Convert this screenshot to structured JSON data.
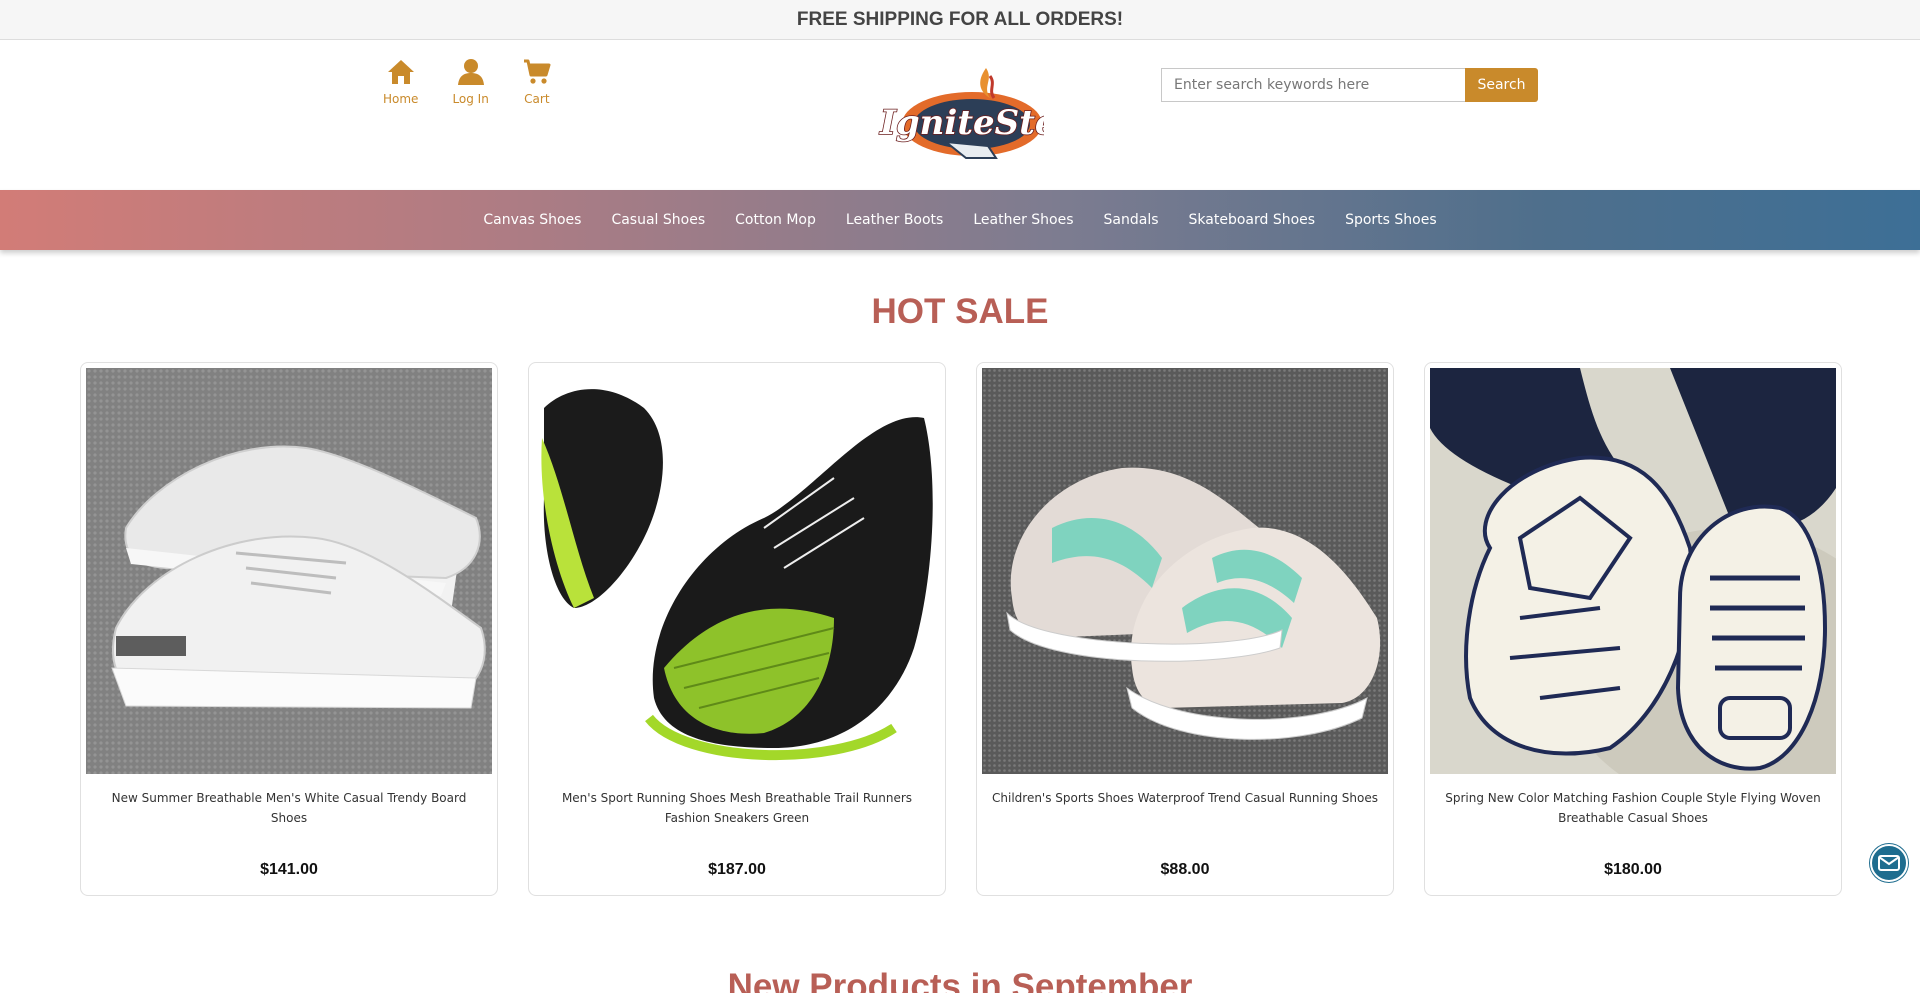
{
  "promo": {
    "text": "FREE SHIPPING FOR ALL ORDERS!"
  },
  "header": {
    "nav": [
      {
        "label": "Home",
        "icon": "home-icon"
      },
      {
        "label": "Log In",
        "icon": "user-icon"
      },
      {
        "label": "Cart",
        "icon": "cart-icon"
      }
    ],
    "logo": {
      "text": "IgniteStep"
    },
    "search": {
      "placeholder": "Enter search keywords here",
      "button_label": "Search"
    }
  },
  "categories": [
    "Canvas Shoes",
    "Casual Shoes",
    "Cotton Mop",
    "Leather Boots",
    "Leather Shoes",
    "Sandals",
    "Skateboard Shoes",
    "Sports Shoes"
  ],
  "hot_sale": {
    "title": "HOT SALE",
    "products": [
      {
        "name": "New Summer Breathable Men's White Casual Trendy Board Shoes",
        "price": "$141.00"
      },
      {
        "name": "Men's Sport Running Shoes Mesh Breathable Trail Runners Fashion Sneakers Green",
        "price": "$187.00"
      },
      {
        "name": "Children's Sports Shoes Waterproof Trend Casual Running Shoes",
        "price": "$88.00"
      },
      {
        "name": "Spring New Color Matching Fashion Couple Style Flying Woven Breathable Casual Shoes",
        "price": "$180.00"
      }
    ]
  },
  "new_products": {
    "title": "New Products in September"
  },
  "colors": {
    "accent": "#c98a2b",
    "section_title": "#b85f56",
    "mail_button": "#1f6d8f"
  }
}
